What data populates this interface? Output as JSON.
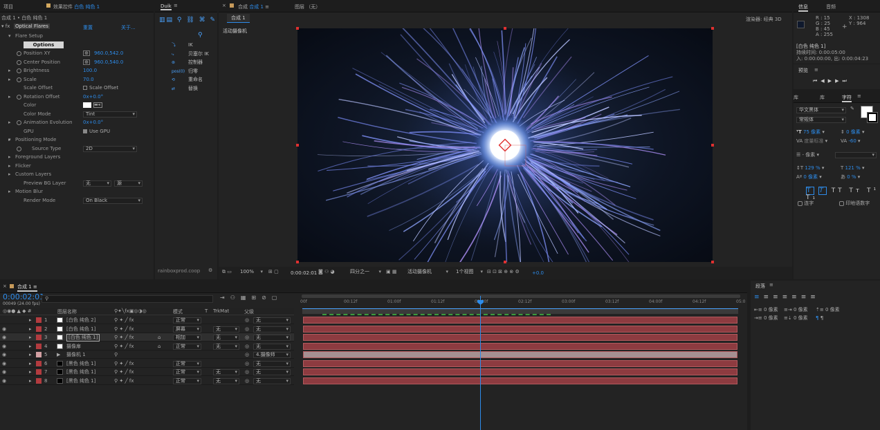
{
  "left_panel": {
    "tab_project": "项目",
    "tab_effects": "效果控件",
    "tab_effects_layer": "白色 纯色 1",
    "breadcrumb": "合成 1 • 白色 纯色 1",
    "fx_name": "Optical Flares",
    "reset": "重置",
    "about": "关于...",
    "rows": [
      {
        "label": "Flare Setup",
        "value": ""
      },
      {
        "label": "Options",
        "value": ""
      },
      {
        "label": "Position XY",
        "value": "960.0,542.0"
      },
      {
        "label": "Center Position",
        "value": "960.0,540.0"
      },
      {
        "label": "Brightness",
        "value": "100.0"
      },
      {
        "label": "Scale",
        "value": "70.0"
      },
      {
        "label": "Scale Offset",
        "value": "Scale Offset"
      },
      {
        "label": "Rotation Offset",
        "value": "0x+0.0°"
      },
      {
        "label": "Color",
        "value": ""
      },
      {
        "label": "Color Mode",
        "value": "Tint"
      },
      {
        "label": "Animation Evolution",
        "value": "0x+0.0°"
      },
      {
        "label": "GPU",
        "value": "Use GPU"
      },
      {
        "label": "Positioning Mode",
        "value": ""
      },
      {
        "label": "Source Type",
        "value": "2D"
      },
      {
        "label": "Foreground Layers",
        "value": ""
      },
      {
        "label": "Flicker",
        "value": ""
      },
      {
        "label": "Custom Layers",
        "value": ""
      },
      {
        "label": "Preview BG Layer",
        "value": "无",
        "value2": "源"
      },
      {
        "label": "Motion Blur",
        "value": ""
      },
      {
        "label": "Render Mode",
        "value": "On Black"
      }
    ]
  },
  "duik": {
    "title": "Duik",
    "items": [
      "IK",
      "贝塞尔 IK",
      "控制器",
      "归零",
      "重命名",
      "替换"
    ],
    "footer": "rainboxprod.coop"
  },
  "comp": {
    "tab": "合成",
    "tab_name": "合成 1",
    "layer_tab": "图层 （无）",
    "subtab": "合成 1",
    "renderer_label": "渲染器:",
    "renderer": "经典 3D",
    "camera_label": "活动摄像机",
    "toolbar": {
      "zoom": "100%",
      "time": "0:00:02:01",
      "res": "四分之一",
      "camera": "活动摄像机",
      "views": "1个视图",
      "exposure": "+0.0"
    }
  },
  "info": {
    "tab_info": "信息",
    "tab_audio": "音频",
    "r": "R : 15",
    "g": "G : 25",
    "b": "B : 45",
    "a": "A : 255",
    "x": "X : 1308",
    "y": "Y : 964",
    "layer": "[白色 纯色 1]",
    "duration": "持续时间: 0:00:05:00",
    "inout": "入: 0:00:00:00,  出: 0:00:04:23"
  },
  "preview": {
    "title": "预览"
  },
  "character": {
    "tab1": "库",
    "tab2": "库",
    "tab3": "字符",
    "font": "华文黑体",
    "style": "常规体",
    "size": "75 像素",
    "leading": "0 像素",
    "kerning": "度量标准",
    "tracking": "-60",
    "stroke": "- 像素",
    "vscale": "129 %",
    "hscale": "121 %",
    "baseline": "0 像素",
    "tsume": "0 %",
    "ligature": "连字",
    "hindi": "印地语数字"
  },
  "paragraph": {
    "title": "段落",
    "v1": "0 像素",
    "v2": "0 像素",
    "v3": "0 像素",
    "v4": "0 像素",
    "v5": "0 像素"
  },
  "timeline": {
    "tab": "合成 1",
    "timecode": "0:00:02:01",
    "frames": "00049 (24.00 fps)",
    "col_name": "图层名称",
    "col_mode": "模式",
    "col_trk": "TrkMat",
    "col_parent": "父级",
    "ticks": [
      "00f",
      "00:12f",
      "01:00f",
      "01:12f",
      "02:00f",
      "02:12f",
      "03:00f",
      "03:12f",
      "04:00f",
      "04:12f",
      "05:0"
    ],
    "layers": [
      {
        "num": "1",
        "name": "[白色 纯色 2]",
        "mode": "正常",
        "trk": "",
        "parent": "无",
        "color": "#b23b3f",
        "swatch": "#ffffff"
      },
      {
        "num": "2",
        "name": "[白色 纯色 1]",
        "mode": "屏幕",
        "trk": "无",
        "parent": "无",
        "color": "#b23b3f",
        "swatch": "#ffffff"
      },
      {
        "num": "3",
        "name": "[白色 纯色 1]",
        "mode": "相加",
        "trk": "无",
        "parent": "无",
        "color": "#b23b3f",
        "swatch": "#ffffff"
      },
      {
        "num": "4",
        "name": "摄像扉",
        "mode": "正常",
        "trk": "无",
        "parent": "无",
        "color": "#b23b3f",
        "swatch": "#ffffff"
      },
      {
        "num": "5",
        "name": "摄像机 1",
        "mode": "",
        "trk": "",
        "parent": "4.摄像师",
        "color": "#d3a0a3",
        "swatch": ""
      },
      {
        "num": "6",
        "name": "[黑色 纯色 1]",
        "mode": "正常",
        "trk": "",
        "parent": "无",
        "color": "#b23b3f",
        "swatch": "#000000"
      },
      {
        "num": "7",
        "name": "[黑色 纯色 1]",
        "mode": "正常",
        "trk": "无",
        "parent": "无",
        "color": "#b23b3f",
        "swatch": "#000000"
      },
      {
        "num": "8",
        "name": "[黑色 纯色 1]",
        "mode": "正常",
        "trk": "无",
        "parent": "无",
        "color": "#b23b3f",
        "swatch": "#000000"
      }
    ]
  }
}
